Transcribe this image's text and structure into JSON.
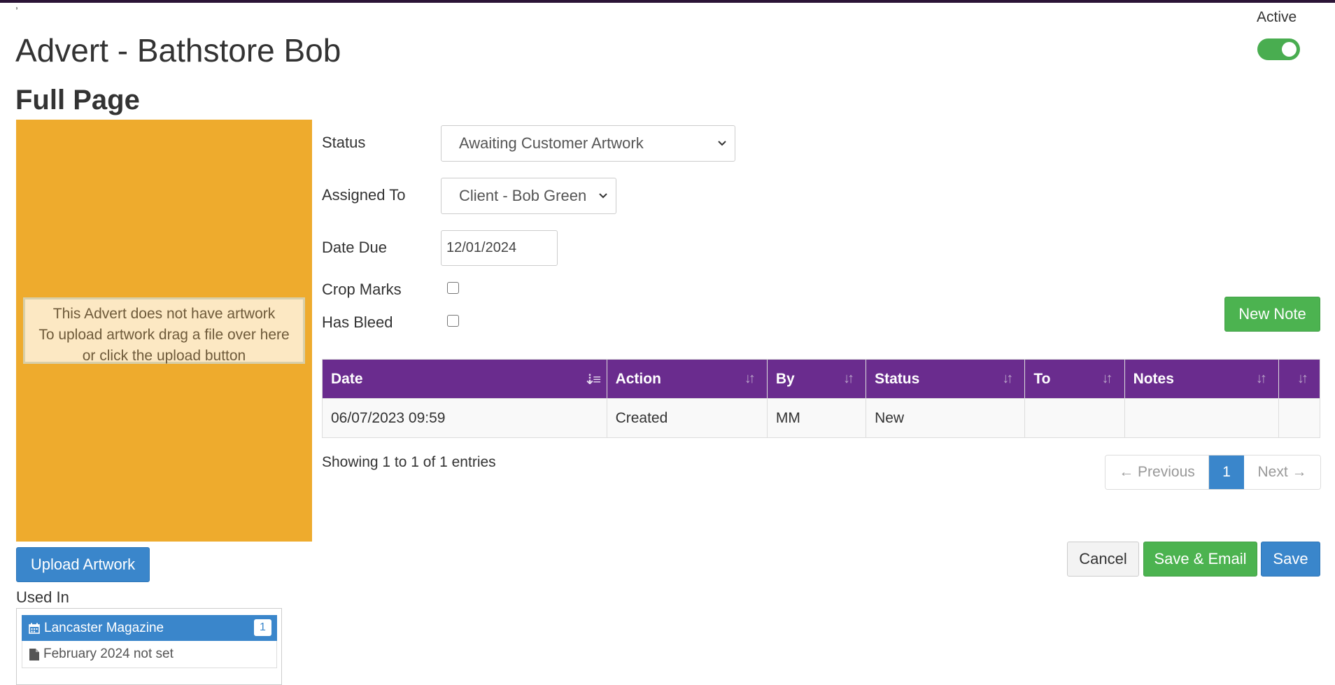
{
  "header": {
    "mark": ",",
    "title": "Advert - Bathstore Bob",
    "subtitle": "Full Page",
    "active_label": "Active",
    "active_on": true
  },
  "artwork": {
    "color": "#eeab2d",
    "message": [
      "This Advert does not have artwork",
      "To upload artwork drag a file over here",
      "or click the upload button"
    ],
    "upload_label": "Upload Artwork"
  },
  "used_in": {
    "label": "Used In",
    "magazine": "Lancaster Magazine",
    "magazine_icon": "calendar-icon",
    "count": "1",
    "issue": "February 2024 not set",
    "issue_icon": "file-icon"
  },
  "form": {
    "status_label": "Status",
    "status_value": "Awaiting Customer Artwork",
    "assigned_label": "Assigned To",
    "assigned_value": "Client - Bob Green",
    "date_label": "Date Due",
    "date_value": "12/01/2024",
    "crop_label": "Crop Marks",
    "crop_checked": false,
    "bleed_label": "Has Bleed",
    "bleed_checked": false
  },
  "notes": {
    "new_note_label": "New Note",
    "columns": [
      "Date",
      "Action",
      "By",
      "Status",
      "To",
      "Notes",
      ""
    ],
    "rows": [
      [
        "06/07/2023 09:59",
        "Created",
        "MM",
        "New",
        "",
        "",
        ""
      ]
    ],
    "showing": "Showing 1 to 1 of 1 entries",
    "pager": {
      "prev": "← Previous",
      "current": "1",
      "next": "Next →"
    },
    "header_color": "#6a2c8e"
  },
  "actions": {
    "cancel": "Cancel",
    "save_email": "Save & Email",
    "save": "Save"
  }
}
